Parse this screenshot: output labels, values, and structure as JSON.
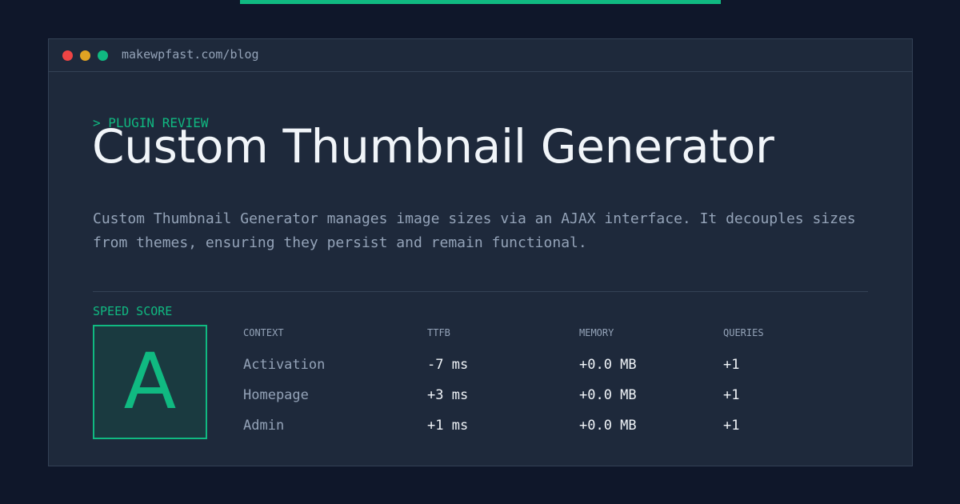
{
  "browser": {
    "url": "makewpfast.com/blog",
    "colors": {
      "close": "#ff5f57",
      "minimize": "#febc2e",
      "maximize": "#28c840"
    }
  },
  "hero": {
    "eyebrow": "> PLUGIN REVIEW",
    "title": "Custom Thumbnail Generator",
    "description": "Custom Thumbnail Generator manages image sizes via an AJAX interface. It decouples sizes from themes, ensuring they persist and remain functional."
  },
  "score": {
    "label": "SPEED SCORE",
    "grade": "A",
    "accent_color": "#10b981"
  },
  "metrics": {
    "headers": [
      "CONTEXT",
      "TTFB",
      "MEMORY",
      "QUERIES"
    ],
    "rows": [
      {
        "context": "Activation",
        "ttfb": "-7 ms",
        "memory": "+0.0 MB",
        "queries": "+1"
      },
      {
        "context": "Homepage",
        "ttfb": "+3 ms",
        "memory": "+0.0 MB",
        "queries": "+1"
      },
      {
        "context": "Admin",
        "ttfb": "+1 ms",
        "memory": "+0.0 MB",
        "queries": "+1"
      }
    ]
  }
}
